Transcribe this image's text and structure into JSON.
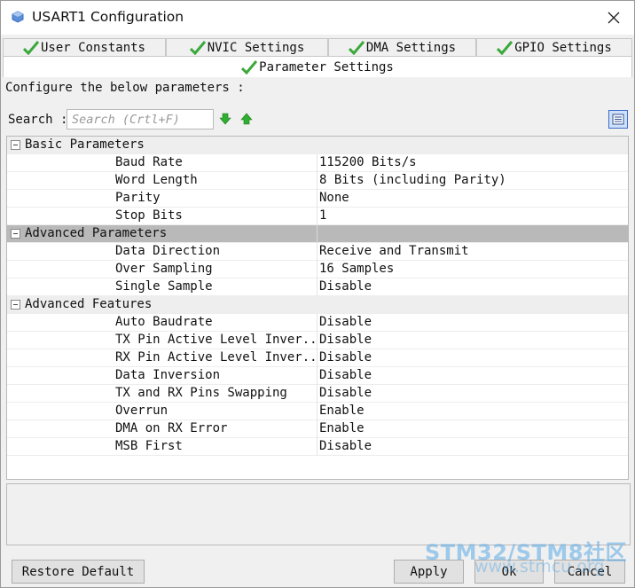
{
  "window": {
    "title": "USART1 Configuration"
  },
  "tabs": [
    {
      "label": "User Constants"
    },
    {
      "label": "NVIC Settings"
    },
    {
      "label": "DMA Settings"
    },
    {
      "label": "GPIO Settings"
    },
    {
      "label": "Parameter Settings"
    }
  ],
  "panel": {
    "config_label": "Configure the below parameters :",
    "search_label": "Search :",
    "search_placeholder": "Search (Crtl+F)"
  },
  "groups": [
    {
      "label": "Basic Parameters",
      "params": [
        {
          "name": "Baud Rate",
          "value": "115200 Bits/s"
        },
        {
          "name": "Word Length",
          "value": "8 Bits (including Parity)"
        },
        {
          "name": "Parity",
          "value": "None"
        },
        {
          "name": "Stop Bits",
          "value": "1"
        }
      ]
    },
    {
      "label": "Advanced Parameters",
      "params": [
        {
          "name": "Data Direction",
          "value": "Receive and Transmit"
        },
        {
          "name": "Over Sampling",
          "value": "16 Samples"
        },
        {
          "name": "Single Sample",
          "value": "Disable"
        }
      ]
    },
    {
      "label": "Advanced Features",
      "params": [
        {
          "name": "Auto Baudrate",
          "value": "Disable"
        },
        {
          "name": "TX Pin Active Level Inver...",
          "value": "Disable"
        },
        {
          "name": "RX Pin Active Level Inver...",
          "value": "Disable"
        },
        {
          "name": "Data Inversion",
          "value": "Disable"
        },
        {
          "name": "TX and RX Pins Swapping",
          "value": "Disable"
        },
        {
          "name": "Overrun",
          "value": "Enable"
        },
        {
          "name": "DMA on RX Error",
          "value": "Enable"
        },
        {
          "name": "MSB First",
          "value": "Disable"
        }
      ]
    }
  ],
  "buttons": {
    "restore": "Restore Default",
    "apply": "Apply",
    "ok": "Ok",
    "cancel": "Cancel"
  },
  "watermark": {
    "line1": "STM32/STM8社区",
    "line2": "www.stmcu.org"
  },
  "colors": {
    "check_green": "#3aa83a",
    "arrow_green": "#2fae2f",
    "selected_group": "#b9b9b9",
    "accent_blue": "#3d6bc9"
  },
  "icons": {
    "app": "cube-icon",
    "close": "close-icon",
    "tab_check": "check-icon",
    "search_next": "arrow-down-icon",
    "search_prev": "arrow-up-icon",
    "view": "list-view-icon",
    "group_toggle": "collapse-icon"
  }
}
